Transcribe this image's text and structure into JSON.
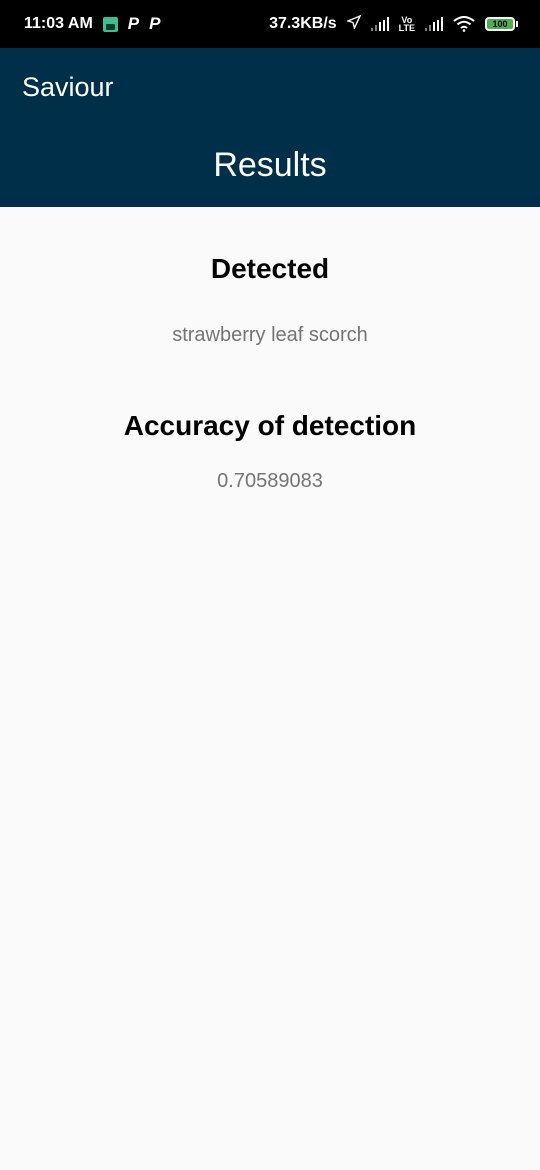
{
  "status_bar": {
    "time": "11:03 AM",
    "net_speed": "37.3KB/s",
    "volte": [
      "Vo",
      "LTE"
    ],
    "battery": "100",
    "icons": [
      "android-app-icon",
      "p-app-icon",
      "p-app-icon",
      "location-arrow-icon",
      "signal-icon",
      "volte-icon",
      "signal-icon",
      "wifi-icon",
      "battery-icon"
    ]
  },
  "app_bar": {
    "title": "Saviour",
    "heading": "Results",
    "background": "#003049"
  },
  "results": {
    "detected_label": "Detected",
    "detected_value": "strawberry leaf scorch",
    "accuracy_label": "Accuracy of detection",
    "accuracy_value": "0.70589083"
  }
}
